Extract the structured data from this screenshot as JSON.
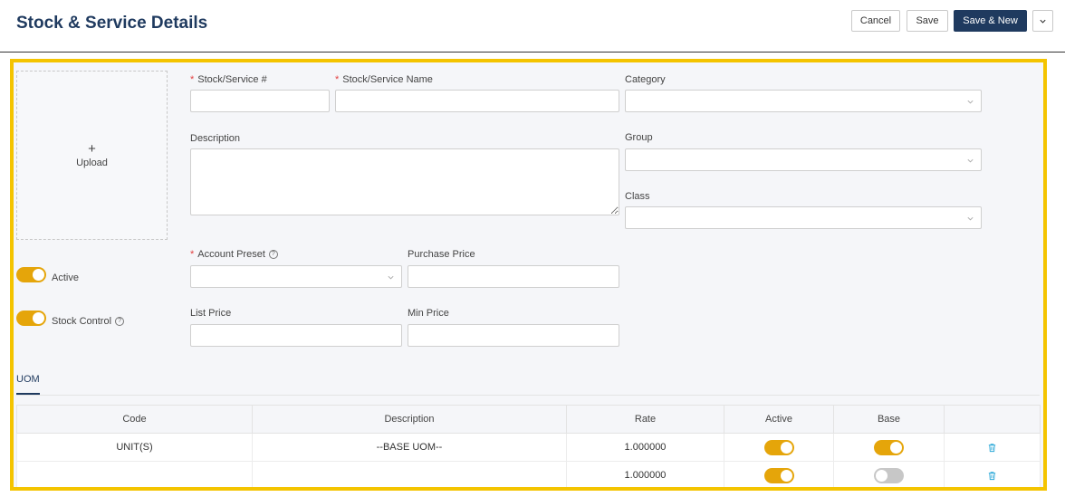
{
  "header": {
    "title": "Stock & Service Details",
    "cancel_label": "Cancel",
    "save_label": "Save",
    "save_new_label": "Save & New"
  },
  "upload": {
    "plus": "+",
    "label": "Upload"
  },
  "form": {
    "stock_no": {
      "label": "Stock/Service #",
      "value": ""
    },
    "stock_name": {
      "label": "Stock/Service Name",
      "value": ""
    },
    "category": {
      "label": "Category",
      "value": ""
    },
    "description": {
      "label": "Description",
      "value": ""
    },
    "group": {
      "label": "Group",
      "value": ""
    },
    "class": {
      "label": "Class",
      "value": ""
    },
    "account_preset": {
      "label": "Account Preset",
      "value": ""
    },
    "purchase_price": {
      "label": "Purchase Price",
      "value": ""
    },
    "list_price": {
      "label": "List Price",
      "value": ""
    },
    "min_price": {
      "label": "Min Price",
      "value": ""
    },
    "required_mark": "*",
    "help_glyph": "?"
  },
  "toggles": {
    "active": {
      "label": "Active",
      "on": true
    },
    "stock_control": {
      "label": "Stock Control",
      "on": true
    }
  },
  "tabs": [
    {
      "label": "UOM",
      "active": true
    }
  ],
  "uom_table": {
    "columns": [
      "Code",
      "Description",
      "Rate",
      "Active",
      "Base",
      ""
    ],
    "rows": [
      {
        "code": "UNIT(S)",
        "description": "--BASE UOM--",
        "rate": "1.000000",
        "active": true,
        "base": true
      },
      {
        "code": "",
        "description": "",
        "rate": "1.000000",
        "active": true,
        "base": false
      }
    ]
  },
  "colors": {
    "brand": "#1f3a5f",
    "toggle_on": "#e5a50a",
    "highlight_border": "#f4c400",
    "required": "#e34040",
    "trash": "#2aa8d8"
  }
}
